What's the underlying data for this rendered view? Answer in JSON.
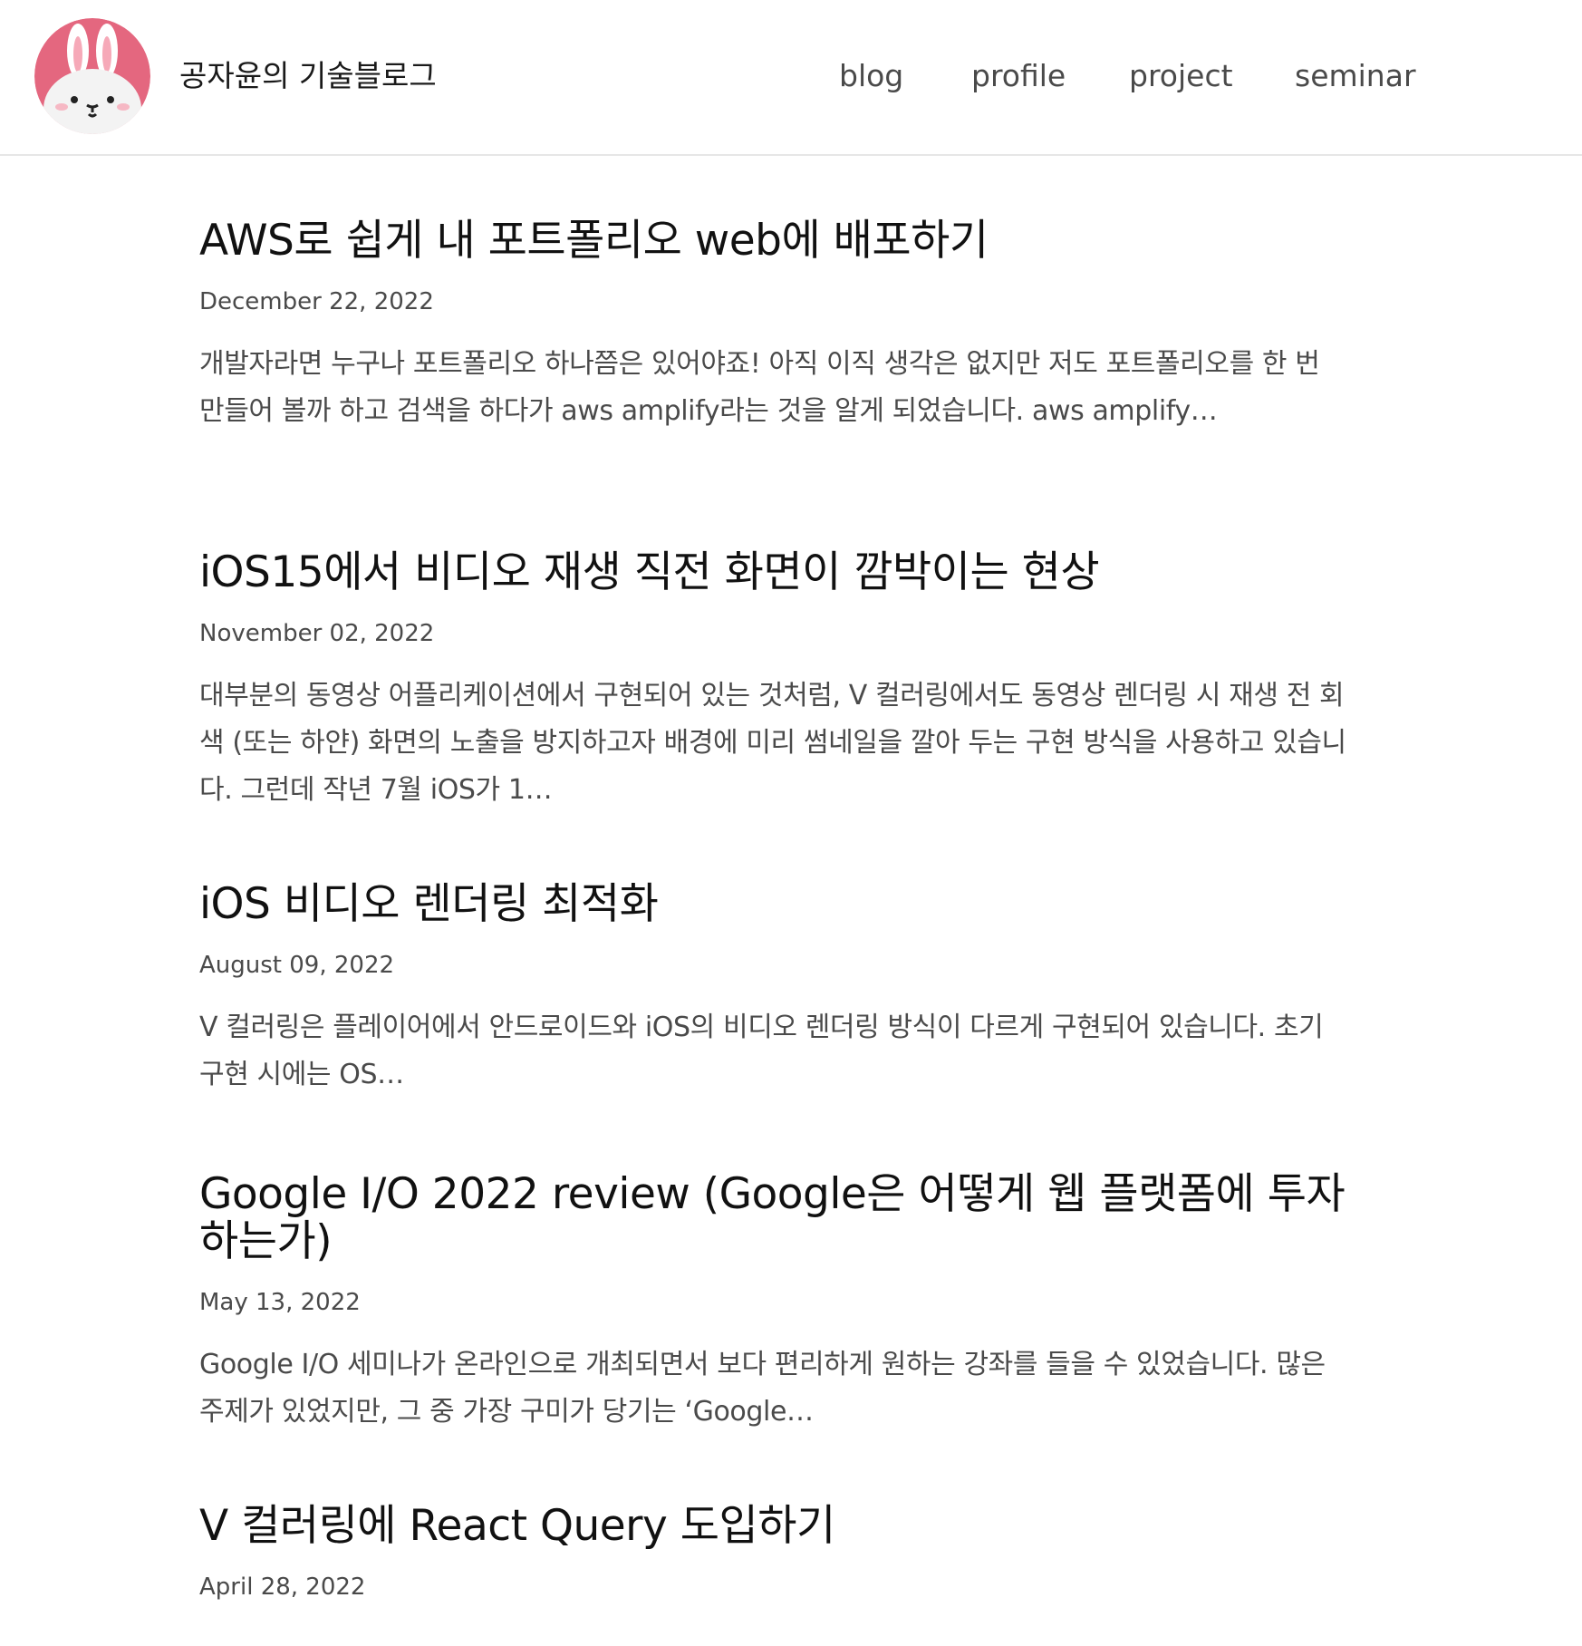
{
  "header": {
    "site_title": "공자윤의 기술블로그",
    "nav": {
      "blog": "blog",
      "profile": "profile",
      "project": "project",
      "seminar": "seminar"
    }
  },
  "posts": [
    {
      "title": "AWS로 쉽게 내 포트폴리오 web에 배포하기",
      "date": "December 22, 2022",
      "excerpt": "개발자라면 누구나 포트폴리오 하나쯤은 있어야죠! 아직 이직 생각은 없지만 저도 포트폴리오를 한 번 만들어 볼까 하고 검색을 하다가 aws amplify라는 것을 알게 되었습니다. aws amplify…"
    },
    {
      "title": "iOS15에서 비디오 재생 직전 화면이 깜박이는 현상",
      "date": "November 02, 2022",
      "excerpt": "대부분의 동영상 어플리케이션에서 구현되어 있는 것처럼, V 컬러링에서도 동영상 렌더링 시 재생 전 회색 (또는 하얀) 화면의 노출을 방지하고자 배경에 미리 썸네일을 깔아 두는 구현 방식을 사용하고 있습니다. 그런데 작년 7월 iOS가 1…"
    },
    {
      "title": "iOS 비디오 렌더링 최적화",
      "date": "August 09, 2022",
      "excerpt": "V 컬러링은 플레이어에서 안드로이드와 iOS의 비디오 렌더링 방식이 다르게 구현되어 있습니다. 초기 구현 시에는 OS…"
    },
    {
      "title": "Google I/O 2022 review (Google은 어떻게 웹 플랫폼에 투자하는가)",
      "date": "May 13, 2022",
      "excerpt": "Google I/O 세미나가 온라인으로 개최되면서 보다 편리하게 원하는 강좌를 들을 수 있었습니다. 많은 주제가 있었지만, 그 중 가장 구미가 당기는 ‘Google…"
    },
    {
      "title": "V 컬러링에 React Query 도입하기",
      "date": "April 28, 2022",
      "excerpt": ""
    }
  ],
  "colors": {
    "avatar_background": "#e4677f",
    "header_border": "#e6e6e6",
    "title_text": "#111111",
    "secondary_text": "#4a4a4a"
  },
  "icons": {
    "avatar": "bunny-character-avatar"
  }
}
